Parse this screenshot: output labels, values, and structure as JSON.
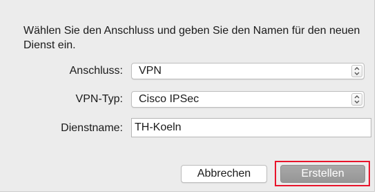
{
  "dialog": {
    "instructions": "Wählen Sie den Anschluss und geben Sie den Namen für den neuen Dienst ein.",
    "interface": {
      "label": "Anschluss:",
      "value": "VPN"
    },
    "vpn_type": {
      "label": "VPN-Typ:",
      "value": "Cisco IPSec"
    },
    "service_name": {
      "label": "Dienstname:",
      "value": "TH-Koeln"
    },
    "buttons": {
      "cancel": "Abbrechen",
      "create": "Erstellen"
    },
    "highlight_color": "#e8132a"
  }
}
